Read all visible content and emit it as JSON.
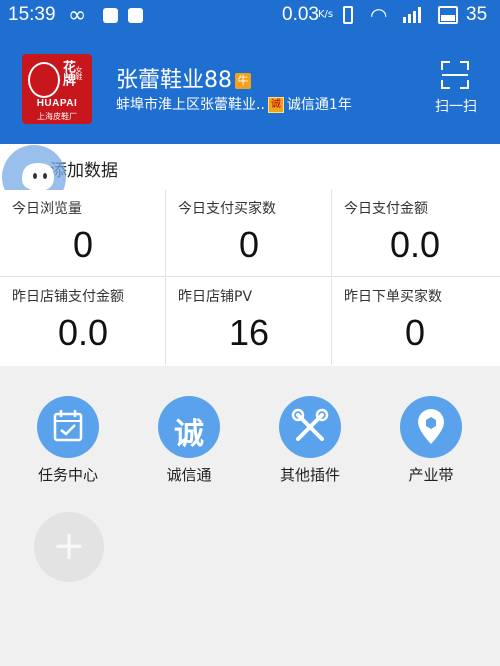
{
  "status_bar": {
    "time": "15:39",
    "net_speed": "0.03",
    "net_unit": "K/s",
    "battery": "35"
  },
  "header": {
    "store_name": "张蕾鞋业88",
    "badge": "牛",
    "address": "蚌埠市淮上区张蕾鞋业..",
    "cert_icon": "诚",
    "cert_text": "诚信通1年",
    "scan_label": "扫一扫",
    "logo_text_en": "HUAPAI",
    "logo_text_cn": "花牌",
    "logo_sub": "上海皮鞋厂",
    "logo_small": "女鞋"
  },
  "add_data": {
    "label": "添加数据"
  },
  "stats": [
    {
      "label": "今日浏览量",
      "value": "0"
    },
    {
      "label": "今日支付买家数",
      "value": "0"
    },
    {
      "label": "今日支付金额",
      "value": "0.0"
    },
    {
      "label": "昨日店铺支付金额",
      "value": "0.0"
    },
    {
      "label": "昨日店铺PV",
      "value": "16"
    },
    {
      "label": "昨日下单买家数",
      "value": "0"
    }
  ],
  "apps": [
    {
      "label": "任务中心",
      "icon": "calendar-check-icon"
    },
    {
      "label": "诚信通",
      "icon": "cheng-icon",
      "glyph": "诚"
    },
    {
      "label": "其他插件",
      "icon": "tools-icon"
    },
    {
      "label": "产业带",
      "icon": "location-pin-icon"
    }
  ],
  "add_app": {
    "icon": "plus-icon",
    "glyph": "+"
  },
  "colors": {
    "primary": "#1f6fd0",
    "app_icon": "#5aa3ec",
    "badge": "#f3a21b"
  }
}
